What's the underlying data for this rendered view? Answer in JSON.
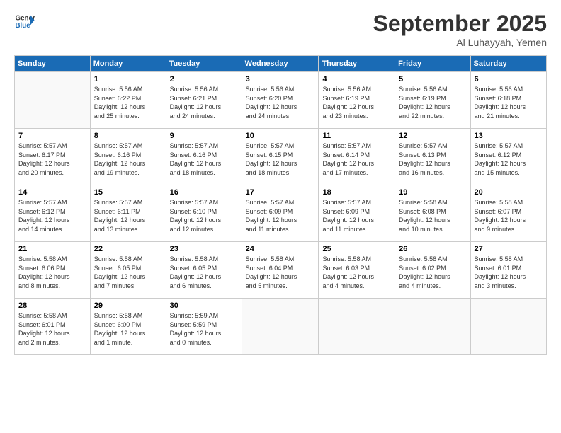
{
  "header": {
    "logo_line1": "General",
    "logo_line2": "Blue",
    "month": "September 2025",
    "location": "Al Luhayyah, Yemen"
  },
  "weekdays": [
    "Sunday",
    "Monday",
    "Tuesday",
    "Wednesday",
    "Thursday",
    "Friday",
    "Saturday"
  ],
  "weeks": [
    [
      {
        "day": "",
        "info": ""
      },
      {
        "day": "1",
        "info": "Sunrise: 5:56 AM\nSunset: 6:22 PM\nDaylight: 12 hours\nand 25 minutes."
      },
      {
        "day": "2",
        "info": "Sunrise: 5:56 AM\nSunset: 6:21 PM\nDaylight: 12 hours\nand 24 minutes."
      },
      {
        "day": "3",
        "info": "Sunrise: 5:56 AM\nSunset: 6:20 PM\nDaylight: 12 hours\nand 24 minutes."
      },
      {
        "day": "4",
        "info": "Sunrise: 5:56 AM\nSunset: 6:19 PM\nDaylight: 12 hours\nand 23 minutes."
      },
      {
        "day": "5",
        "info": "Sunrise: 5:56 AM\nSunset: 6:19 PM\nDaylight: 12 hours\nand 22 minutes."
      },
      {
        "day": "6",
        "info": "Sunrise: 5:56 AM\nSunset: 6:18 PM\nDaylight: 12 hours\nand 21 minutes."
      }
    ],
    [
      {
        "day": "7",
        "info": "Sunrise: 5:57 AM\nSunset: 6:17 PM\nDaylight: 12 hours\nand 20 minutes."
      },
      {
        "day": "8",
        "info": "Sunrise: 5:57 AM\nSunset: 6:16 PM\nDaylight: 12 hours\nand 19 minutes."
      },
      {
        "day": "9",
        "info": "Sunrise: 5:57 AM\nSunset: 6:16 PM\nDaylight: 12 hours\nand 18 minutes."
      },
      {
        "day": "10",
        "info": "Sunrise: 5:57 AM\nSunset: 6:15 PM\nDaylight: 12 hours\nand 18 minutes."
      },
      {
        "day": "11",
        "info": "Sunrise: 5:57 AM\nSunset: 6:14 PM\nDaylight: 12 hours\nand 17 minutes."
      },
      {
        "day": "12",
        "info": "Sunrise: 5:57 AM\nSunset: 6:13 PM\nDaylight: 12 hours\nand 16 minutes."
      },
      {
        "day": "13",
        "info": "Sunrise: 5:57 AM\nSunset: 6:12 PM\nDaylight: 12 hours\nand 15 minutes."
      }
    ],
    [
      {
        "day": "14",
        "info": "Sunrise: 5:57 AM\nSunset: 6:12 PM\nDaylight: 12 hours\nand 14 minutes."
      },
      {
        "day": "15",
        "info": "Sunrise: 5:57 AM\nSunset: 6:11 PM\nDaylight: 12 hours\nand 13 minutes."
      },
      {
        "day": "16",
        "info": "Sunrise: 5:57 AM\nSunset: 6:10 PM\nDaylight: 12 hours\nand 12 minutes."
      },
      {
        "day": "17",
        "info": "Sunrise: 5:57 AM\nSunset: 6:09 PM\nDaylight: 12 hours\nand 11 minutes."
      },
      {
        "day": "18",
        "info": "Sunrise: 5:57 AM\nSunset: 6:09 PM\nDaylight: 12 hours\nand 11 minutes."
      },
      {
        "day": "19",
        "info": "Sunrise: 5:58 AM\nSunset: 6:08 PM\nDaylight: 12 hours\nand 10 minutes."
      },
      {
        "day": "20",
        "info": "Sunrise: 5:58 AM\nSunset: 6:07 PM\nDaylight: 12 hours\nand 9 minutes."
      }
    ],
    [
      {
        "day": "21",
        "info": "Sunrise: 5:58 AM\nSunset: 6:06 PM\nDaylight: 12 hours\nand 8 minutes."
      },
      {
        "day": "22",
        "info": "Sunrise: 5:58 AM\nSunset: 6:05 PM\nDaylight: 12 hours\nand 7 minutes."
      },
      {
        "day": "23",
        "info": "Sunrise: 5:58 AM\nSunset: 6:05 PM\nDaylight: 12 hours\nand 6 minutes."
      },
      {
        "day": "24",
        "info": "Sunrise: 5:58 AM\nSunset: 6:04 PM\nDaylight: 12 hours\nand 5 minutes."
      },
      {
        "day": "25",
        "info": "Sunrise: 5:58 AM\nSunset: 6:03 PM\nDaylight: 12 hours\nand 4 minutes."
      },
      {
        "day": "26",
        "info": "Sunrise: 5:58 AM\nSunset: 6:02 PM\nDaylight: 12 hours\nand 4 minutes."
      },
      {
        "day": "27",
        "info": "Sunrise: 5:58 AM\nSunset: 6:01 PM\nDaylight: 12 hours\nand 3 minutes."
      }
    ],
    [
      {
        "day": "28",
        "info": "Sunrise: 5:58 AM\nSunset: 6:01 PM\nDaylight: 12 hours\nand 2 minutes."
      },
      {
        "day": "29",
        "info": "Sunrise: 5:58 AM\nSunset: 6:00 PM\nDaylight: 12 hours\nand 1 minute."
      },
      {
        "day": "30",
        "info": "Sunrise: 5:59 AM\nSunset: 5:59 PM\nDaylight: 12 hours\nand 0 minutes."
      },
      {
        "day": "",
        "info": ""
      },
      {
        "day": "",
        "info": ""
      },
      {
        "day": "",
        "info": ""
      },
      {
        "day": "",
        "info": ""
      }
    ]
  ]
}
